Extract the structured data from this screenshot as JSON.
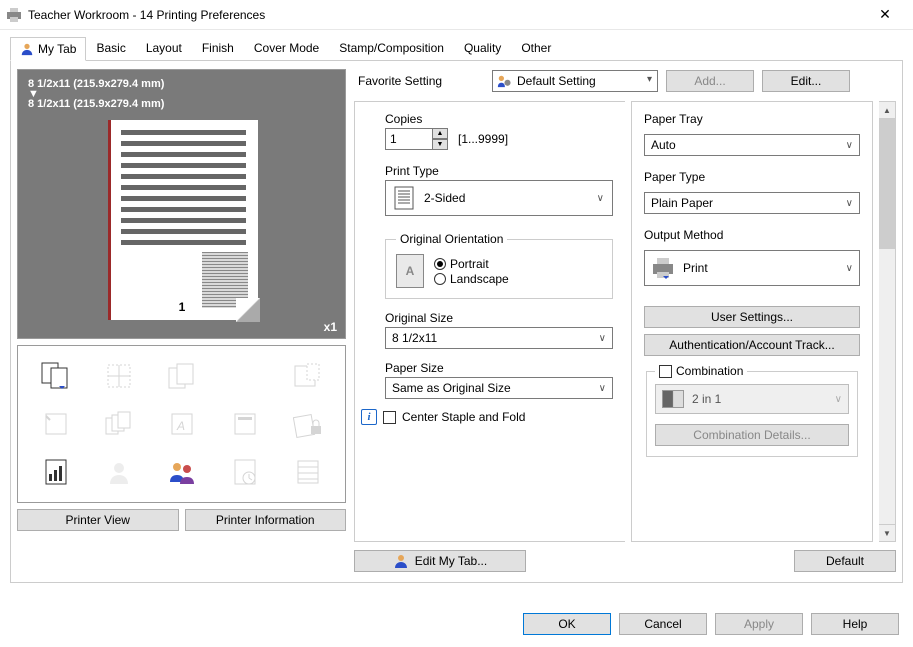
{
  "window": {
    "title": "Teacher Workroom - 14 Printing Preferences"
  },
  "tabs": [
    "My Tab",
    "Basic",
    "Layout",
    "Finish",
    "Cover Mode",
    "Stamp/Composition",
    "Quality",
    "Other"
  ],
  "active_tab": "My Tab",
  "preview": {
    "size_from": "8 1/2x11 (215.9x279.4 mm)",
    "size_to": "8 1/2x11 (215.9x279.4 mm)",
    "multiplier": "x1",
    "page_number": "1"
  },
  "left_buttons": {
    "printer_view": "Printer View",
    "printer_info": "Printer Information"
  },
  "favorite": {
    "label": "Favorite Setting",
    "value": "Default Setting",
    "add": "Add...",
    "edit": "Edit..."
  },
  "copies": {
    "label": "Copies",
    "value": "1",
    "range": "[1...9999]"
  },
  "print_type": {
    "label": "Print Type",
    "value": "2-Sided"
  },
  "orientation": {
    "legend": "Original Orientation",
    "portrait": "Portrait",
    "landscape": "Landscape",
    "selected": "portrait"
  },
  "original_size": {
    "label": "Original Size",
    "value": "8 1/2x11"
  },
  "paper_size": {
    "label": "Paper Size",
    "value": "Same as Original Size"
  },
  "center_staple": {
    "label": "Center Staple and Fold"
  },
  "paper_tray": {
    "label": "Paper Tray",
    "value": "Auto"
  },
  "paper_type": {
    "label": "Paper Type",
    "value": "Plain Paper"
  },
  "output_method": {
    "label": "Output Method",
    "value": "Print"
  },
  "user_settings": "User Settings...",
  "auth_track": "Authentication/Account Track...",
  "combination": {
    "legend": "Combination",
    "value": "2 in 1",
    "details": "Combination Details..."
  },
  "edit_my_tab": "Edit My Tab...",
  "default_btn": "Default",
  "dialog": {
    "ok": "OK",
    "cancel": "Cancel",
    "apply": "Apply",
    "help": "Help"
  }
}
